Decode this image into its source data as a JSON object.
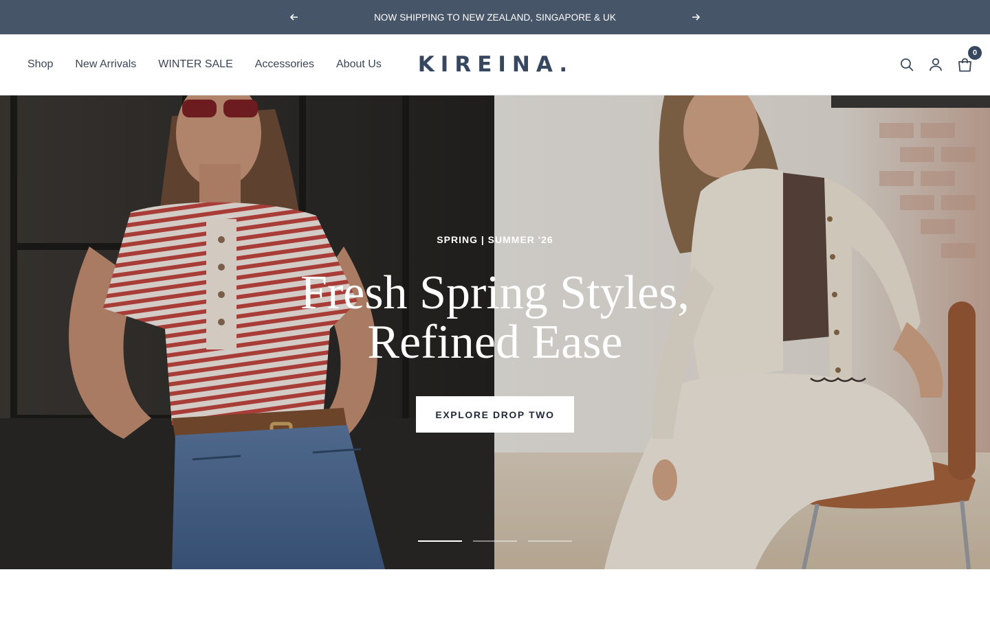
{
  "announcement": {
    "text": "NOW SHIPPING TO NEW ZEALAND, SINGAPORE & UK",
    "prev_icon": "arrow-left-icon",
    "next_icon": "arrow-right-icon"
  },
  "header": {
    "nav": [
      "Shop",
      "New Arrivals",
      "WINTER SALE",
      "Accessories",
      "About Us"
    ],
    "logo": "KIREINA.",
    "icons": [
      "search-icon",
      "account-icon",
      "cart-icon"
    ],
    "cart_count": "0"
  },
  "hero": {
    "eyebrow": "SPRING | SUMMER '26",
    "title_line1": "Fresh Spring Styles,",
    "title_line2": "Refined Ease",
    "button_label": "EXPLORE DROP TWO",
    "slides_total": 3,
    "active_slide": 1
  },
  "colors": {
    "announcement_bg": "#475569",
    "brand": "#36475f",
    "text": "#3a4556"
  }
}
